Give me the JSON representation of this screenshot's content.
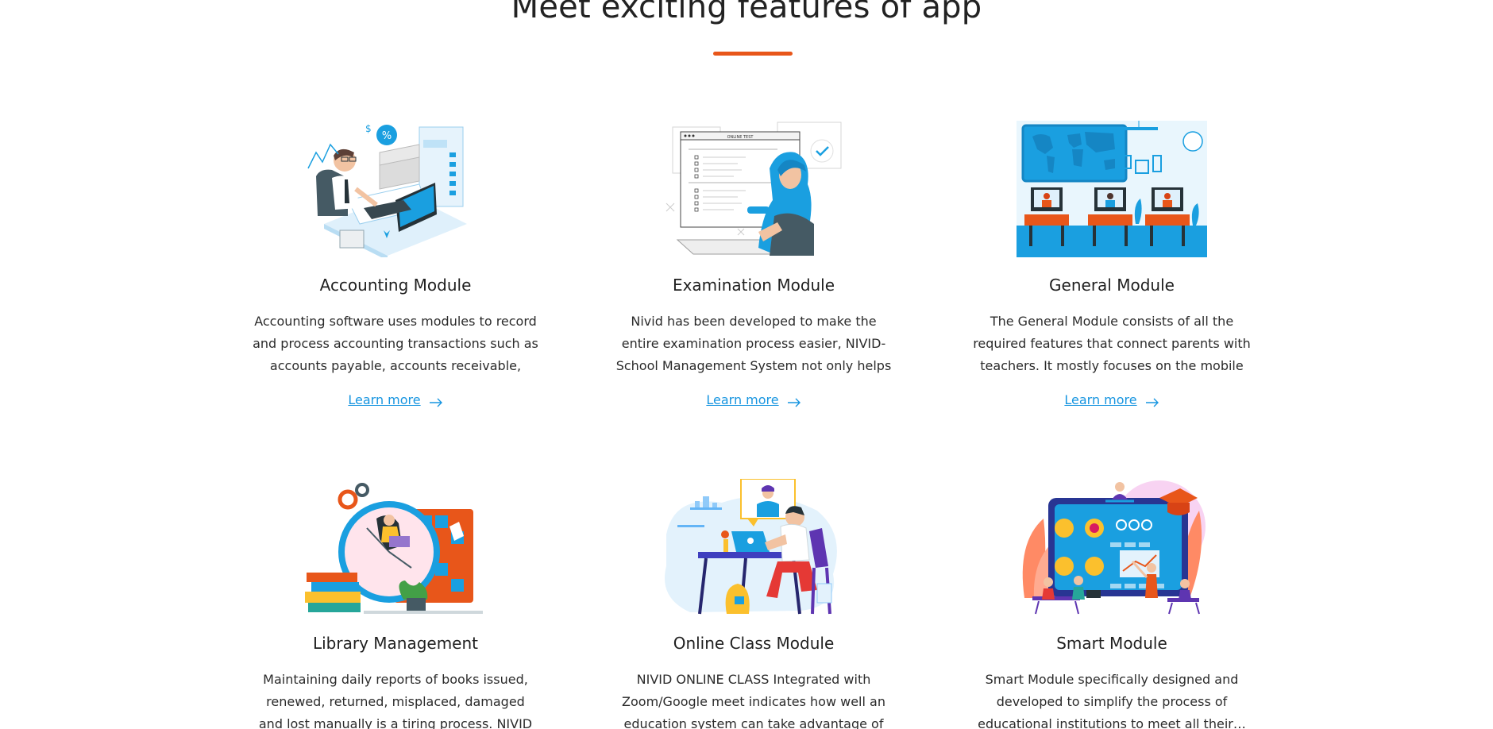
{
  "section": {
    "title": "Meet exciting features of app"
  },
  "cards": [
    {
      "title": "Accounting Module",
      "description": "Accounting software uses modules to record and process accounting transactions such as accounts payable, accounts receivable, and…",
      "link": "Learn more",
      "illustration": "accountant-at-desk-illustration"
    },
    {
      "title": "Examination Module",
      "description": "Nivid has been developed to make the entire examination process easier, NIVID- School Management System not only helps you to…",
      "link": "Learn more",
      "illustration": "online-test-illustration"
    },
    {
      "title": "General Module",
      "description": "The General Module consists of all the required features that connect parents with teachers. It mostly focuses on the mobile app feature of…",
      "link": "Learn more",
      "illustration": "classroom-world-map-illustration"
    },
    {
      "title": "Library Management",
      "description": "Maintaining daily reports of books issued, renewed, returned, misplaced, damaged and lost manually is a tiring process. NIVID library…",
      "illustration": "clock-books-calendar-illustration"
    },
    {
      "title": "Online Class Module",
      "description": "NIVID ONLINE CLASS Integrated with Zoom/Google meet indicates how well an education system can take advantage of new…",
      "illustration": "student-video-call-illustration"
    },
    {
      "title": "Smart Module",
      "description": "Smart Module specifically designed and developed to simplify the process of educational institutions to meet all their…",
      "illustration": "smart-board-students-illustration"
    }
  ],
  "colors": {
    "accent": "#e8561a",
    "link": "#1795e0",
    "primary_blue": "#1a9fe0"
  }
}
